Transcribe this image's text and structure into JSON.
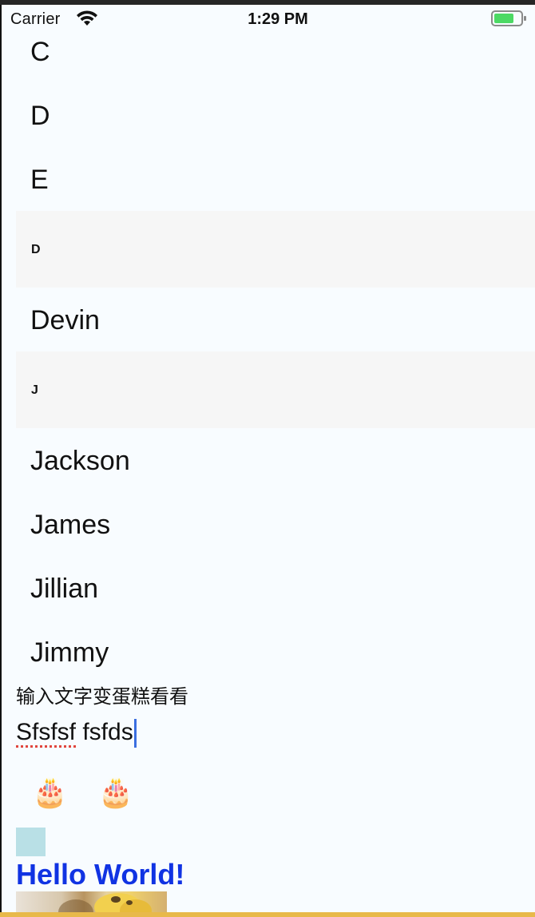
{
  "status_bar": {
    "carrier": "Carrier",
    "time": "1:29 PM",
    "wifi_icon": "wifi-icon",
    "battery_icon": "battery-icon",
    "battery_color": "#4cd964"
  },
  "list": {
    "rows_top": [
      {
        "label": "C"
      },
      {
        "label": "D"
      },
      {
        "label": "E"
      }
    ],
    "section_d": {
      "header": "D",
      "items": [
        {
          "label": "Devin"
        }
      ]
    },
    "section_j": {
      "header": "J",
      "items": [
        {
          "label": "Jackson"
        },
        {
          "label": "James"
        },
        {
          "label": "Jillian"
        },
        {
          "label": "Jimmy"
        }
      ]
    }
  },
  "cake_input": {
    "prompt": "输入文字变蛋糕看看",
    "value_misspelled": "Sfsfsf",
    "value_rest": " fsfds",
    "cakes": [
      "🎂",
      "🎂"
    ]
  },
  "swatch_color": "#b9e0e6",
  "hello": {
    "text": "Hello World!",
    "color": "#1033e3"
  },
  "image": {
    "icon": "banana-image"
  }
}
